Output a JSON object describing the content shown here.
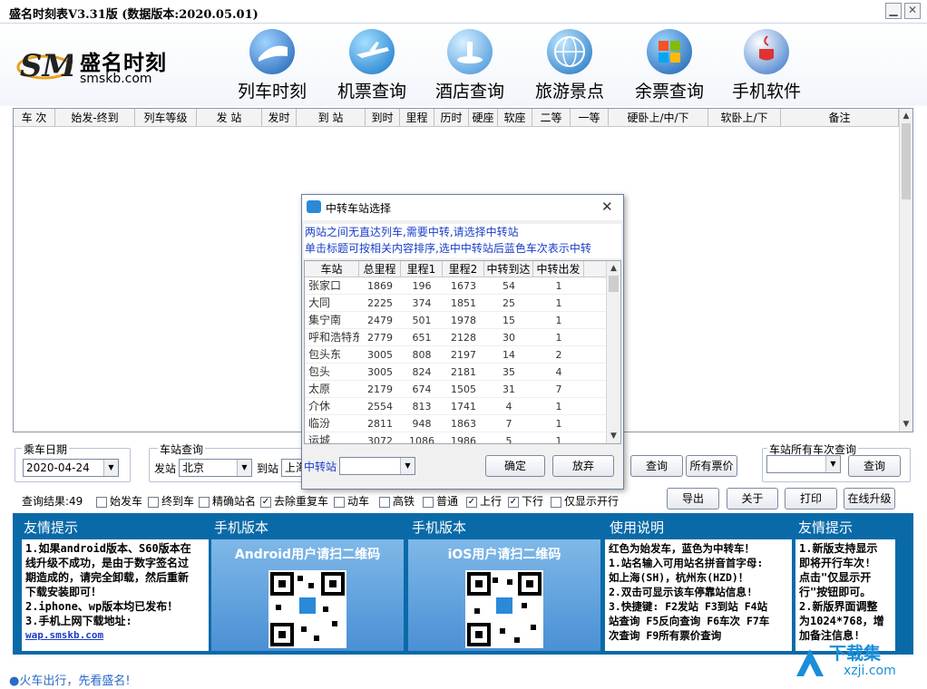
{
  "window": {
    "title": "盛名时刻表V3.31版 (数据版本:2020.05.01)",
    "minimize": "▁",
    "close": "✕"
  },
  "logo": {
    "mark": "SM",
    "name": "盛名时刻",
    "url": "smskb.com"
  },
  "nav": [
    {
      "label": "列车时刻",
      "icon": "train-icon"
    },
    {
      "label": "机票查询",
      "icon": "airplane-icon"
    },
    {
      "label": "酒店查询",
      "icon": "hotel-icon"
    },
    {
      "label": "旅游景点",
      "icon": "globe-icon"
    },
    {
      "label": "余票查询",
      "icon": "windows-logo-icon"
    },
    {
      "label": "手机软件",
      "icon": "java-icon"
    }
  ],
  "grid": {
    "columns": [
      "车 次",
      "始发-终到",
      "列车等级",
      "发 站",
      "发时",
      "到 站",
      "到时",
      "里程",
      "历时",
      "硬座",
      "软座",
      "二等",
      "一等",
      "硬卧上/中/下",
      "软卧上/下",
      "备注"
    ]
  },
  "date_group": {
    "label": "乘车日期",
    "value": "2020-04-24"
  },
  "station_group": {
    "label": "车站查询",
    "from_label": "发站",
    "from_value": "北京",
    "to_label": "到站",
    "to_value": "上海"
  },
  "buttons": {
    "query": "查询",
    "all_prices": "所有票价",
    "station_query": "查询",
    "export": "导出",
    "about": "关于",
    "print": "打印",
    "upgrade": "在线升级"
  },
  "station_all_group": {
    "label": "车站所有车次查询",
    "value": ""
  },
  "filters": {
    "result_label": "查询结果:49",
    "items": [
      {
        "label": "始发车",
        "checked": false
      },
      {
        "label": "终到车",
        "checked": false
      },
      {
        "label": "精确站名",
        "checked": false
      },
      {
        "label": "去除重复车",
        "checked": true
      },
      {
        "label": "动车",
        "checked": false
      },
      {
        "label": "高铁",
        "checked": false
      },
      {
        "label": "普通",
        "checked": false
      },
      {
        "label": "上行",
        "checked": true
      },
      {
        "label": "下行",
        "checked": true
      },
      {
        "label": "仅显示开行",
        "checked": false
      }
    ]
  },
  "panels": {
    "friendly1": {
      "title": "友情提示",
      "lines": [
        "1.如果android版本、S60版本在",
        "线升级不成功，是由于数字签名过",
        "期造成的，请完全卸载，然后重新",
        "下载安装即可！",
        "2.iphone、wp版本均已发布！",
        "3.手机上网下载地址:"
      ],
      "link": "wap.smskb.com"
    },
    "mobile_android": {
      "title": "手机版本",
      "qr_title": "Android用户请扫二维码"
    },
    "mobile_ios": {
      "title": "手机版本",
      "qr_title": "iOS用户请扫二维码"
    },
    "usage": {
      "title": "使用说明",
      "lines": [
        "红色为始发车，蓝色为中转车！",
        "1.站名输入可用站名拼音首字母:",
        "如上海(SH)，杭州东(HZD)！",
        "2.双击可显示该车停靠站信息!",
        "3.快捷键: F2发站 F3到站 F4站",
        "站查询 F5反向查询 F6车次 F7车",
        "次查询 F9所有票价查询"
      ]
    },
    "friendly2": {
      "title": "友情提示",
      "lines": [
        "1.新版支持显示",
        "即将开行车次!",
        "点击\"仅显示开",
        "行\"按钮即可。",
        "2.新版界面调整",
        "为1024*768，增",
        "加备注信息!"
      ]
    }
  },
  "footer": {
    "slogan": "●火车出行，先看盛名!",
    "watermark_cn": "下载集",
    "watermark_url": "xzji.com"
  },
  "dialog": {
    "title": "中转车站选择",
    "info_line1": "两站之间无直达列车,需要中转,请选择中转站",
    "info_line2": "单击标题可按相关内容排序,选中中转站后蓝色车次表示中转",
    "columns": [
      "车站",
      "总里程",
      "里程1",
      "里程2",
      "中转到达",
      "中转出发"
    ],
    "rows": [
      [
        "张家口",
        "1869",
        "196",
        "1673",
        "54",
        "1"
      ],
      [
        "大同",
        "2225",
        "374",
        "1851",
        "25",
        "1"
      ],
      [
        "集宁南",
        "2479",
        "501",
        "1978",
        "15",
        "1"
      ],
      [
        "呼和浩特东",
        "2779",
        "651",
        "2128",
        "30",
        "1"
      ],
      [
        "包头东",
        "3005",
        "808",
        "2197",
        "14",
        "2"
      ],
      [
        "包头",
        "3005",
        "824",
        "2181",
        "35",
        "4"
      ],
      [
        "太原",
        "2179",
        "674",
        "1505",
        "31",
        "7"
      ],
      [
        "介休",
        "2554",
        "813",
        "1741",
        "4",
        "1"
      ],
      [
        "临汾",
        "2811",
        "948",
        "1863",
        "7",
        "1"
      ],
      [
        "运城",
        "3072",
        "1086",
        "1986",
        "5",
        "1"
      ]
    ],
    "transfer_label": "中转站",
    "transfer_value": "",
    "ok": "确定",
    "cancel": "放弃",
    "close": "✕"
  }
}
